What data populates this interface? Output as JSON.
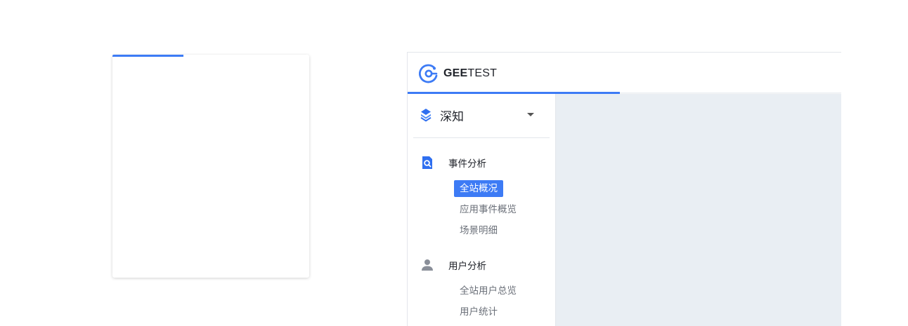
{
  "loader": {
    "progress_percent": 36
  },
  "header": {
    "brand_strong": "GEE",
    "brand_rest": "TEST",
    "page_progress_percent": 49
  },
  "product_switcher": {
    "name": "深知"
  },
  "nav": [
    {
      "label": "事件分析",
      "icon": "search-doc-icon",
      "items": [
        {
          "label": "全站概况",
          "active": true
        },
        {
          "label": "应用事件概览",
          "active": false
        },
        {
          "label": "场景明细",
          "active": false
        }
      ]
    },
    {
      "label": "用户分析",
      "icon": "user-icon",
      "items": [
        {
          "label": "全站用户总览",
          "active": false
        },
        {
          "label": "用户统计",
          "active": false
        }
      ]
    }
  ],
  "colors": {
    "accent": "#3d7bf5",
    "content_bg": "#e9eef3"
  }
}
